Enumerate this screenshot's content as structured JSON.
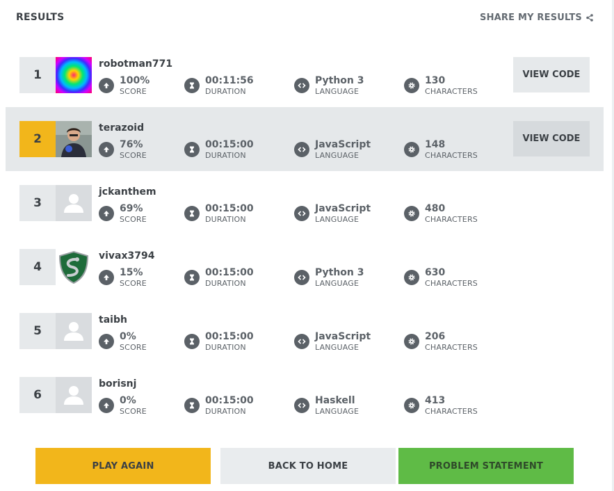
{
  "header": {
    "title": "RESULTS",
    "share_label": "SHARE MY RESULTS"
  },
  "labels": {
    "score": "SCORE",
    "duration": "DURATION",
    "language": "LANGUAGE",
    "characters": "CHARACTERS",
    "view_code": "VIEW CODE"
  },
  "colors": {
    "gold": "#f2b61b",
    "green": "#5fbb46",
    "highlight": "#e5e8ea"
  },
  "players": [
    {
      "rank": "1",
      "username": "robotman771",
      "score": "100%",
      "duration": "00:11:56",
      "language": "Python 3",
      "characters": "130",
      "avatar": "rainbow-gradient",
      "view_code": true
    },
    {
      "rank": "2",
      "username": "terazoid",
      "score": "76%",
      "duration": "00:15:00",
      "language": "JavaScript",
      "characters": "148",
      "avatar": "photo-person",
      "view_code": true,
      "highlighted": true
    },
    {
      "rank": "3",
      "username": "jckanthem",
      "score": "69%",
      "duration": "00:15:00",
      "language": "JavaScript",
      "characters": "480",
      "avatar": "default-user"
    },
    {
      "rank": "4",
      "username": "vivax3794",
      "score": "15%",
      "duration": "00:15:00",
      "language": "Python 3",
      "characters": "630",
      "avatar": "green-serpent-crest"
    },
    {
      "rank": "5",
      "username": "taibh",
      "score": "0%",
      "duration": "00:15:00",
      "language": "JavaScript",
      "characters": "206",
      "avatar": "default-user"
    },
    {
      "rank": "6",
      "username": "borisnj",
      "score": "0%",
      "duration": "00:15:00",
      "language": "Haskell",
      "characters": "413",
      "avatar": "default-user"
    }
  ],
  "buttons": {
    "play_again": "PLAY AGAIN",
    "back_home": "BACK TO HOME",
    "problem_statement": "PROBLEM STATEMENT"
  }
}
